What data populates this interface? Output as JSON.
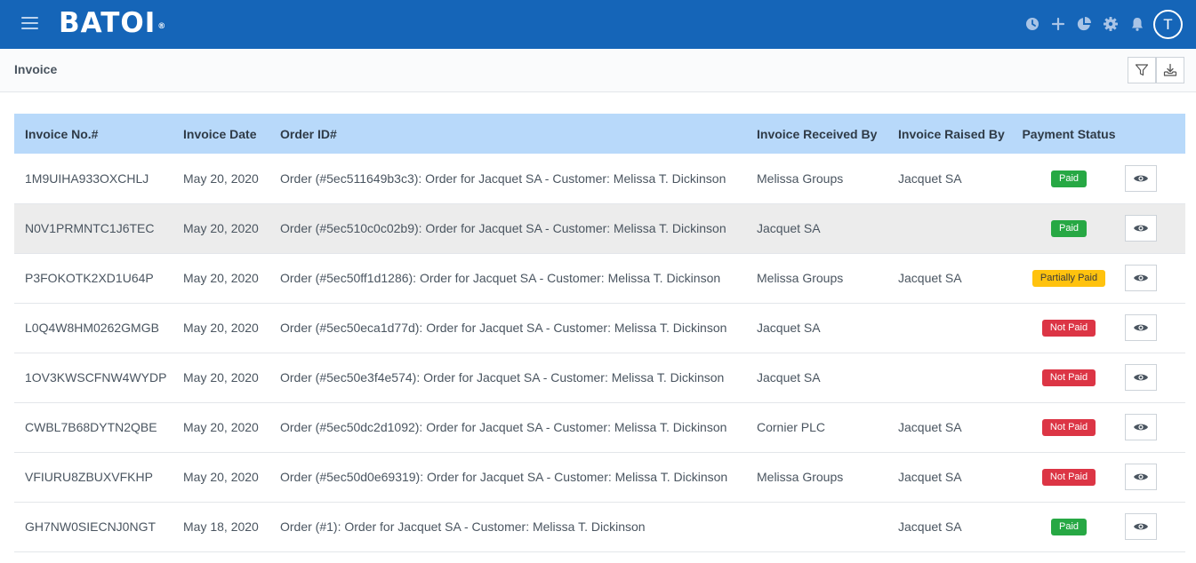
{
  "header": {
    "brand": "BATOI",
    "brand_mark": "®",
    "avatar_initial": "T",
    "icons": [
      "clock-icon",
      "plus-icon",
      "pie-chart-icon",
      "gear-icon",
      "bell-icon"
    ]
  },
  "page": {
    "title": "Invoice"
  },
  "table": {
    "columns": {
      "invoice_no": "Invoice No.#",
      "invoice_date": "Invoice Date",
      "order_id": "Order ID#",
      "received_by": "Invoice Received By",
      "raised_by": "Invoice Raised By",
      "payment_status": "Payment Status"
    },
    "rows": [
      {
        "invoice_no": "1M9UIHA933OXCHLJ",
        "date": "May 20, 2020",
        "order": "Order (#5ec511649b3c3): Order for Jacquet SA - Customer: Melissa T. Dickinson",
        "received_by": "Melissa Groups",
        "raised_by": "Jacquet SA",
        "status": "Paid"
      },
      {
        "invoice_no": "N0V1PRMNTC1J6TEC",
        "date": "May 20, 2020",
        "order": "Order (#5ec510c0c02b9): Order for Jacquet SA - Customer: Melissa T. Dickinson",
        "received_by": "Jacquet SA",
        "raised_by": "",
        "status": "Paid"
      },
      {
        "invoice_no": "P3FOKOTK2XD1U64P",
        "date": "May 20, 2020",
        "order": "Order (#5ec50ff1d1286): Order for Jacquet SA - Customer: Melissa T. Dickinson",
        "received_by": "Melissa Groups",
        "raised_by": "Jacquet SA",
        "status": "Partially Paid"
      },
      {
        "invoice_no": "L0Q4W8HM0262GMGB",
        "date": "May 20, 2020",
        "order": "Order (#5ec50eca1d77d): Order for Jacquet SA - Customer: Melissa T. Dickinson",
        "received_by": "Jacquet SA",
        "raised_by": "",
        "status": "Not Paid"
      },
      {
        "invoice_no": "1OV3KWSCFNW4WYDP",
        "date": "May 20, 2020",
        "order": "Order (#5ec50e3f4e574): Order for Jacquet SA - Customer: Melissa T. Dickinson",
        "received_by": "Jacquet SA",
        "raised_by": "",
        "status": "Not Paid"
      },
      {
        "invoice_no": "CWBL7B68DYTN2QBE",
        "date": "May 20, 2020",
        "order": "Order (#5ec50dc2d1092): Order for Jacquet SA - Customer: Melissa T. Dickinson",
        "received_by": "Cornier PLC",
        "raised_by": "Jacquet SA",
        "status": "Not Paid"
      },
      {
        "invoice_no": "VFIURU8ZBUXVFKHP",
        "date": "May 20, 2020",
        "order": "Order (#5ec50d0e69319): Order for Jacquet SA - Customer: Melissa T. Dickinson",
        "received_by": "Melissa Groups",
        "raised_by": "Jacquet SA",
        "status": "Not Paid"
      },
      {
        "invoice_no": "GH7NW0SIECNJ0NGT",
        "date": "May 18, 2020",
        "order": "Order (#1): Order for Jacquet SA - Customer: Melissa T. Dickinson",
        "received_by": "",
        "raised_by": "Jacquet SA",
        "status": "Paid"
      }
    ]
  },
  "colors": {
    "topbar": "#1565b8",
    "table_header": "#b8d9fa",
    "paid": "#27a844",
    "partially_paid": "#ffc20e",
    "not_paid": "#dc3545"
  }
}
